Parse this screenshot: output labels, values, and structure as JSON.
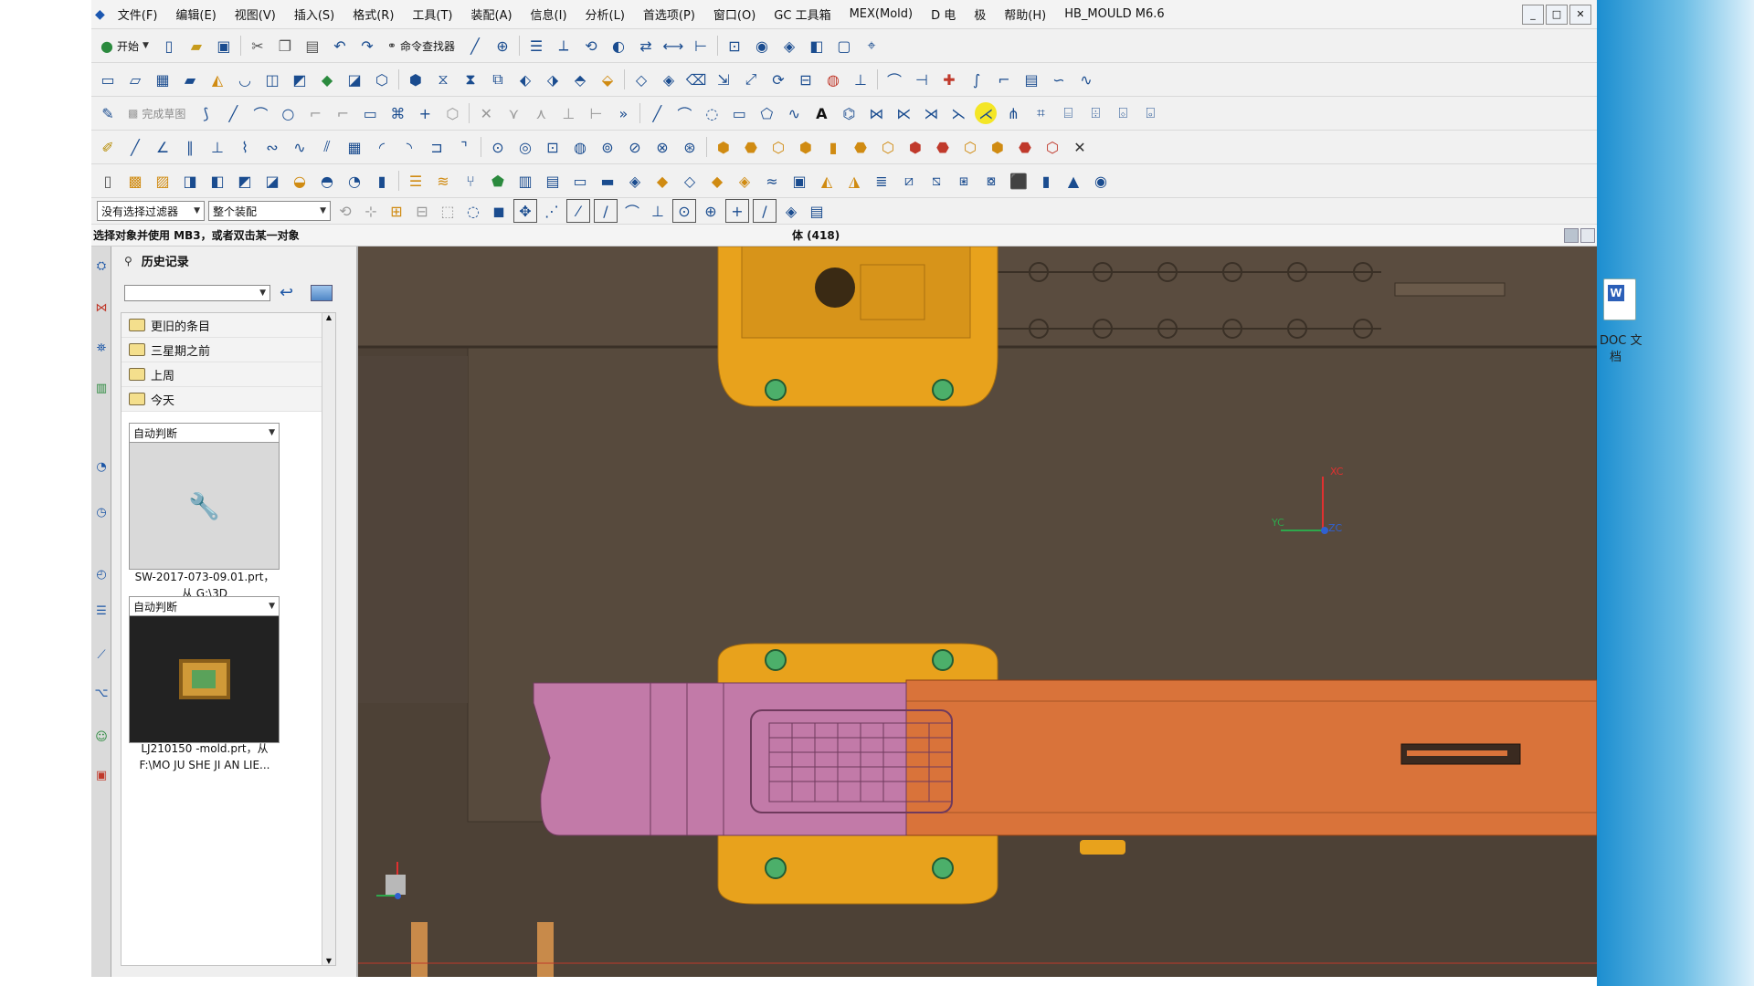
{
  "menubar": {
    "items": [
      "文件(F)",
      "编辑(E)",
      "视图(V)",
      "插入(S)",
      "格式(R)",
      "工具(T)",
      "装配(A)",
      "信息(I)",
      "分析(L)",
      "首选项(P)",
      "窗口(O)",
      "GC 工具箱",
      "MEX(Mold)",
      "D 电",
      "极",
      "帮助(H)",
      "HB_MOULD M6.6"
    ],
    "window_min": "_",
    "window_max": "□",
    "window_close": "✕"
  },
  "toolbar1": {
    "start_label": "开始",
    "command_finder_label": "命令查找器"
  },
  "sketch_toolbar": {
    "finish_sketch_label": "完成草图",
    "text_glyph": "A"
  },
  "selection_bar": {
    "filter_value": "没有选择过滤器",
    "scope_value": "整个装配"
  },
  "status": {
    "prompt": "选择对象并使用 MB3，或者双击某一对象",
    "selection_info": "体 (418)"
  },
  "history_panel": {
    "title": "历史记录",
    "folders": [
      "更旧的条目",
      "三星期之前",
      "上周",
      "今天"
    ],
    "entries": [
      {
        "filter": "自动判断",
        "name": "SW-2017-073-09.01.prt，",
        "path": "从 G:\\3D"
      },
      {
        "filter": "自动判断",
        "name": "LJ210150 -mold.prt，从",
        "path": "F:\\MO JU SHE JI AN LIE..."
      }
    ]
  },
  "viewport": {
    "triad_labels": {
      "xc": "XC",
      "yc": "YC",
      "zc": "ZC"
    }
  },
  "desktop": {
    "doc_label": "DOC 文",
    "doc_label2": "档"
  },
  "colors": {
    "viewport_bg": "#4d4136",
    "mold_plate_yellow": "#e8a21c",
    "part_orange": "#d9733a",
    "part_pink": "#c27aa8",
    "desktop_blue": "#1c8ed0"
  }
}
